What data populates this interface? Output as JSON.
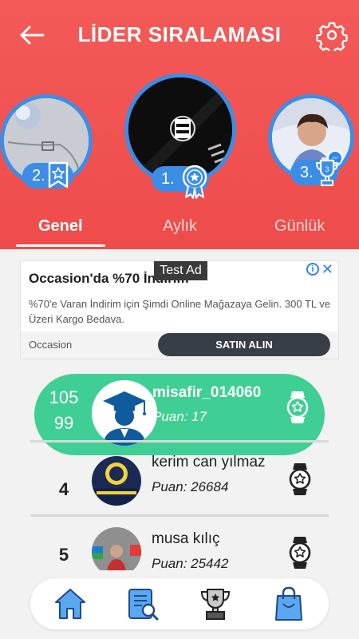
{
  "header": {
    "title": "LİDER SIRALAMASI",
    "back_icon": "arrow-left-icon",
    "settings_icon": "gear-icon"
  },
  "podium": [
    {
      "place": "2.",
      "badge_icon": "ribbon-star-icon"
    },
    {
      "place": "1.",
      "badge_icon": "medal-star-icon"
    },
    {
      "place": "3.",
      "badge_icon": "trophy-icon"
    }
  ],
  "tabs": [
    {
      "label": "Genel",
      "active": true
    },
    {
      "label": "Aylık",
      "active": false
    },
    {
      "label": "Günlük",
      "active": false
    }
  ],
  "ad": {
    "test_label": "Test Ad",
    "title": "Occasion'da %70 İndirim",
    "description": "%70'e Varan İndirim için Şimdi Online Mağazaya Gelin. 300 TL ve Üzeri Kargo Bedava.",
    "brand": "Occasion",
    "cta": "SATIN ALIN",
    "info_icon": "info-icon",
    "close_icon": "close-icon"
  },
  "me": {
    "rank_top": "105",
    "rank_bottom": "99",
    "name": "misafir_014060",
    "score": "Puan: 17"
  },
  "leaderboard": [
    {
      "rank": "4",
      "name": "kerim can yılmaz",
      "score": "Puan: 26684"
    },
    {
      "rank": "5",
      "name": "musa kılıç",
      "score": "Puan: 25442"
    }
  ],
  "nav": [
    {
      "icon": "home-icon"
    },
    {
      "icon": "list-search-icon"
    },
    {
      "icon": "trophy-icon"
    },
    {
      "icon": "shopping-bag-icon"
    }
  ],
  "colors": {
    "header_bg": "#ef5250",
    "accent_blue": "#3c8de6",
    "my_card_green": "#3fcf94"
  }
}
